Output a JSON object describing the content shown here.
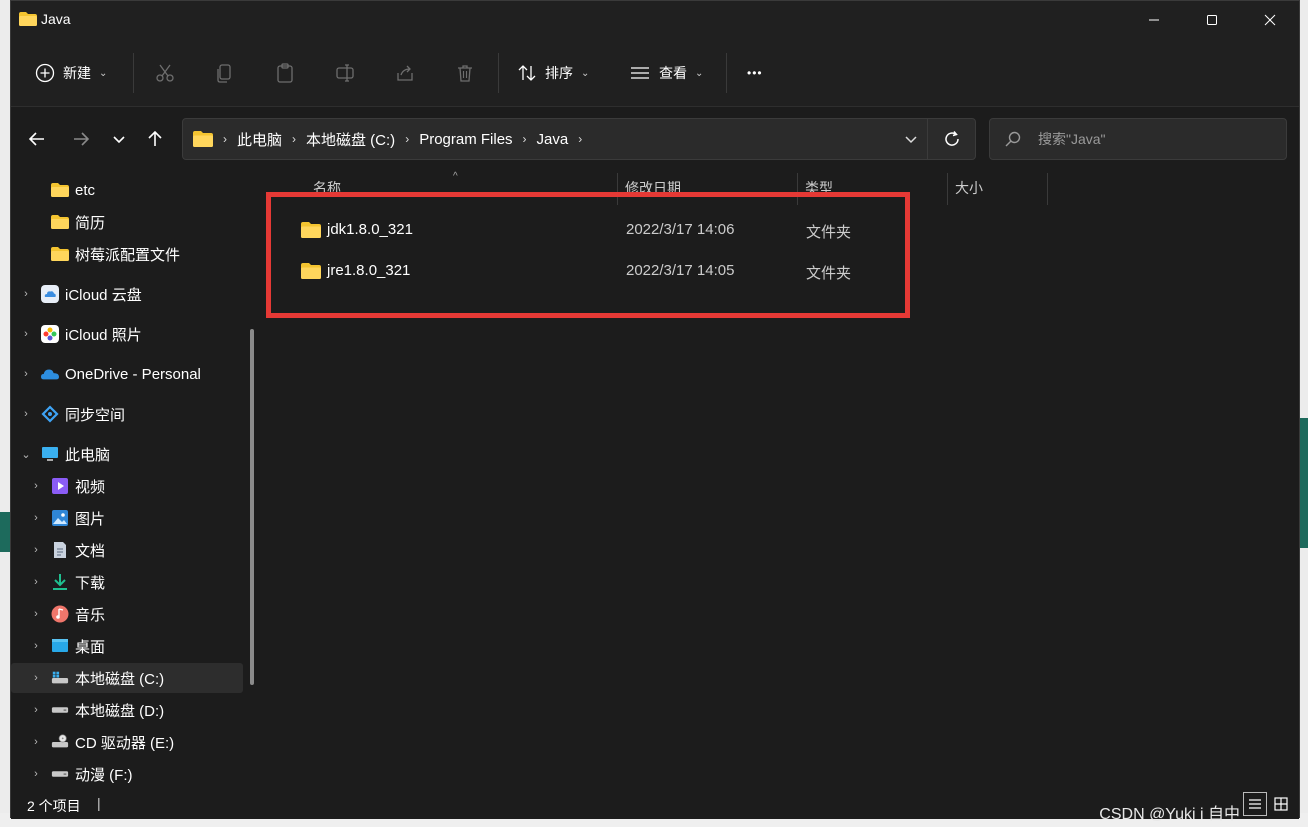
{
  "window": {
    "title": "Java",
    "minimize_label": "—",
    "maximize_label": "☐",
    "close_label": "✕"
  },
  "toolbar": {
    "new_label": "新建",
    "sort_label": "排序",
    "view_label": "查看",
    "more_label": "•••"
  },
  "nav": {
    "breadcrumb": [
      "此电脑",
      "本地磁盘 (C:)",
      "Program Files",
      "Java"
    ]
  },
  "search": {
    "placeholder": "搜索\"Java\""
  },
  "sidebar": {
    "items": [
      {
        "label": "etc",
        "icon": "folder-icon"
      },
      {
        "label": "简历",
        "icon": "folder-icon"
      },
      {
        "label": "树莓派配置文件",
        "icon": "folder-icon"
      },
      {
        "label": "iCloud 云盘",
        "icon": "icloud-drive-icon"
      },
      {
        "label": "iCloud 照片",
        "icon": "icloud-photos-icon"
      },
      {
        "label": "OneDrive - Personal",
        "icon": "onedrive-icon"
      },
      {
        "label": "同步空间",
        "icon": "sync-space-icon"
      },
      {
        "label": "此电脑",
        "icon": "this-pc-icon"
      },
      {
        "label": "视频",
        "icon": "videos-icon"
      },
      {
        "label": "图片",
        "icon": "pictures-icon"
      },
      {
        "label": "文档",
        "icon": "documents-icon"
      },
      {
        "label": "下载",
        "icon": "downloads-icon"
      },
      {
        "label": "音乐",
        "icon": "music-icon"
      },
      {
        "label": "桌面",
        "icon": "desktop-icon"
      },
      {
        "label": "本地磁盘 (C:)",
        "icon": "drive-c-icon"
      },
      {
        "label": "本地磁盘 (D:)",
        "icon": "drive-d-icon"
      },
      {
        "label": "CD 驱动器 (E:)",
        "icon": "cd-drive-icon"
      },
      {
        "label": "动漫 (F:)",
        "icon": "drive-f-icon"
      }
    ]
  },
  "columns": {
    "name": "名称",
    "modified": "修改日期",
    "type": "类型",
    "size": "大小"
  },
  "files": [
    {
      "name": "jdk1.8.0_321",
      "modified": "2022/3/17 14:06",
      "type": "文件夹"
    },
    {
      "name": "jre1.8.0_321",
      "modified": "2022/3/17 14:05",
      "type": "文件夹"
    }
  ],
  "status": {
    "count": "2 个项目",
    "separator": "|"
  },
  "watermark": "CSDN @Yuki i 自中",
  "colors": {
    "highlight": "#e53935",
    "folder": "#f4c430",
    "background": "#1c1c1c"
  }
}
